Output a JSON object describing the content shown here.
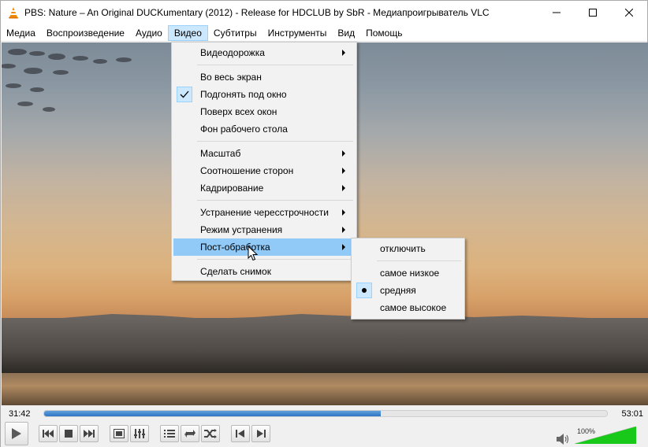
{
  "window": {
    "title": "PBS: Nature – An Original DUCKumentary (2012) - Release for HDCLUB by SbR - Медиапроигрыватель VLC",
    "icon": "vlc-cone-icon"
  },
  "menubar": {
    "items": [
      "Медиа",
      "Воспроизведение",
      "Аудио",
      "Видео",
      "Субтитры",
      "Инструменты",
      "Вид",
      "Помощь"
    ],
    "open_item": "Видео"
  },
  "video_menu": {
    "items": [
      {
        "label": "Видеодорожка",
        "submenu": true
      },
      {
        "label": "Во весь экран"
      },
      {
        "label": "Подгонять под окно",
        "checked": true
      },
      {
        "label": "Поверх всех окон"
      },
      {
        "label": "Фон рабочего стола"
      },
      {
        "label": "Масштаб",
        "submenu": true
      },
      {
        "label": "Соотношение сторон",
        "submenu": true
      },
      {
        "label": "Кадрирование",
        "submenu": true
      },
      {
        "label": "Устранение чересстрочности",
        "submenu": true
      },
      {
        "label": "Режим устранения",
        "submenu": true
      },
      {
        "label": "Пост-обработка",
        "submenu": true,
        "highlighted": true
      },
      {
        "label": "Сделать снимок"
      }
    ]
  },
  "postprocess_menu": {
    "items": [
      {
        "label": "отключить"
      },
      {
        "label": "самое низкое"
      },
      {
        "label": "средняя",
        "selected": true
      },
      {
        "label": "самое высокое"
      }
    ]
  },
  "player": {
    "elapsed": "31:42",
    "duration": "53:01",
    "progress_fraction": 0.5978,
    "volume_label": "100%",
    "volume_fraction": 1.0,
    "colors": {
      "seek_fill": "#2e75c4",
      "volume_fill": "#19c919",
      "menu_highlight": "#91c9f7",
      "check_bg": "#cce8ff"
    },
    "buttons": [
      "play",
      "previous",
      "stop",
      "next",
      "fullscreen",
      "extended-settings",
      "playlist",
      "loop",
      "shuffle",
      "frame-back",
      "frame-forward"
    ]
  }
}
